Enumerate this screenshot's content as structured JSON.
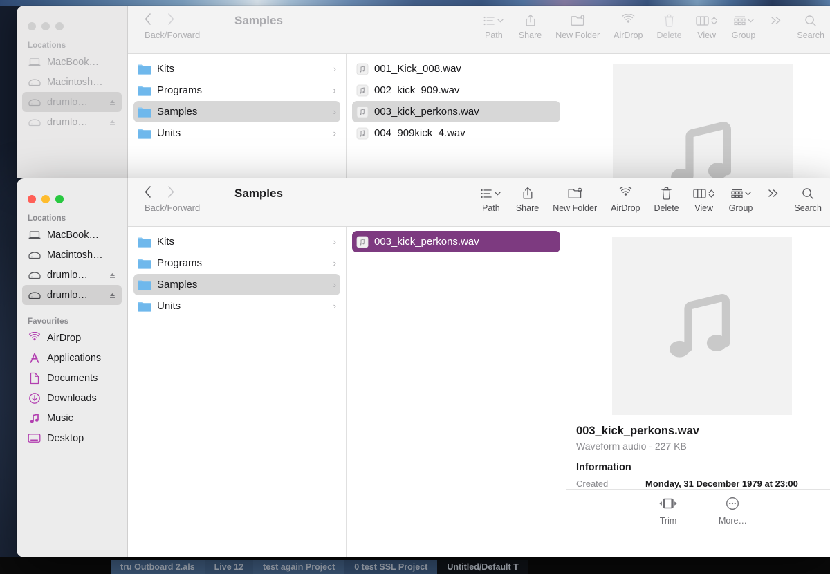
{
  "desktop": {
    "background_top_color": "#5b7fa8",
    "background_color": "#1a2336"
  },
  "background_window": {
    "name": "finder-window-background",
    "title": "Samples",
    "nav": {
      "back_label": "‹",
      "forward_label": "›",
      "caption": "Back/Forward"
    },
    "toolbar": [
      {
        "name": "path",
        "label": "Path"
      },
      {
        "name": "share",
        "label": "Share"
      },
      {
        "name": "new-folder",
        "label": "New Folder"
      },
      {
        "name": "airdrop",
        "label": "AirDrop"
      },
      {
        "name": "delete",
        "label": "Delete"
      },
      {
        "name": "view",
        "label": "View"
      },
      {
        "name": "group",
        "label": "Group"
      },
      {
        "name": "more",
        "label": ""
      },
      {
        "name": "search",
        "label": "Search"
      }
    ],
    "sidebar": {
      "locations_title": "Locations",
      "items": [
        {
          "label": "MacBook…",
          "icon": "laptop-icon",
          "eject": false
        },
        {
          "label": "Macintosh…",
          "icon": "drive-icon",
          "eject": false
        },
        {
          "label": "drumlo…",
          "icon": "drive-icon",
          "eject": true,
          "selected": true
        },
        {
          "label": "drumlo…",
          "icon": "drive-icon",
          "eject": true
        }
      ]
    },
    "folders": [
      {
        "label": "Kits"
      },
      {
        "label": "Programs"
      },
      {
        "label": "Samples",
        "selected": true
      },
      {
        "label": "Units"
      }
    ],
    "files": [
      {
        "label": "001_Kick_008.wav"
      },
      {
        "label": "002_kick_909.wav"
      },
      {
        "label": "003_kick_perkons.wav",
        "selected": true
      },
      {
        "label": "004_909kick_4.wav"
      }
    ]
  },
  "front_window": {
    "name": "finder-window-front",
    "title": "Samples",
    "nav": {
      "back_label": "‹",
      "forward_label": "›",
      "caption": "Back/Forward"
    },
    "toolbar": [
      {
        "name": "path",
        "label": "Path"
      },
      {
        "name": "share",
        "label": "Share"
      },
      {
        "name": "new-folder",
        "label": "New Folder"
      },
      {
        "name": "airdrop",
        "label": "AirDrop"
      },
      {
        "name": "delete",
        "label": "Delete"
      },
      {
        "name": "view",
        "label": "View"
      },
      {
        "name": "group",
        "label": "Group"
      },
      {
        "name": "more",
        "label": ""
      },
      {
        "name": "search",
        "label": "Search"
      }
    ],
    "sidebar": {
      "locations_title": "Locations",
      "favourites_title": "Favourites",
      "locations": [
        {
          "label": "MacBook…",
          "icon": "laptop-icon",
          "eject": false
        },
        {
          "label": "Macintosh…",
          "icon": "drive-icon",
          "eject": false
        },
        {
          "label": "drumlo…",
          "icon": "drive-icon",
          "eject": true
        },
        {
          "label": "drumlo…",
          "icon": "drive-icon",
          "eject": true,
          "selected": true
        }
      ],
      "favourites": [
        {
          "label": "AirDrop",
          "icon": "airdrop-icon"
        },
        {
          "label": "Applications",
          "icon": "applications-icon"
        },
        {
          "label": "Documents",
          "icon": "document-icon"
        },
        {
          "label": "Downloads",
          "icon": "downloads-icon"
        },
        {
          "label": "Music",
          "icon": "music-icon"
        },
        {
          "label": "Desktop",
          "icon": "desktop-icon"
        }
      ]
    },
    "folders": [
      {
        "label": "Kits"
      },
      {
        "label": "Programs"
      },
      {
        "label": "Samples",
        "selected": true
      },
      {
        "label": "Units"
      }
    ],
    "files": [
      {
        "label": "003_kick_perkons.wav",
        "selected": true
      }
    ],
    "preview": {
      "thumbnail_icon": "music-note-icon",
      "file_name": "003_kick_perkons.wav",
      "file_subtitle": "Waveform audio - 227 KB",
      "information_heading": "Information",
      "created_key": "Created",
      "created_value": "Monday, 31 December 1979 at 23:00",
      "actions": [
        {
          "name": "trim",
          "label": "Trim",
          "icon": "trim-icon"
        },
        {
          "name": "more",
          "label": "More…",
          "icon": "ellipsis-circle-icon"
        }
      ]
    }
  },
  "taskbar": {
    "items": [
      {
        "label": "tru Outboard 2.als"
      },
      {
        "label": "Live 12"
      },
      {
        "label": "test again Project"
      },
      {
        "label": "0 test SSL Project"
      },
      {
        "label": "Untitled/Default T"
      }
    ]
  },
  "colors": {
    "selection_purple": "#7d3a80",
    "selection_gray": "#d7d7d7",
    "folder_blue": "#74bdf0",
    "sidebar_accent": "#b23fb0"
  }
}
